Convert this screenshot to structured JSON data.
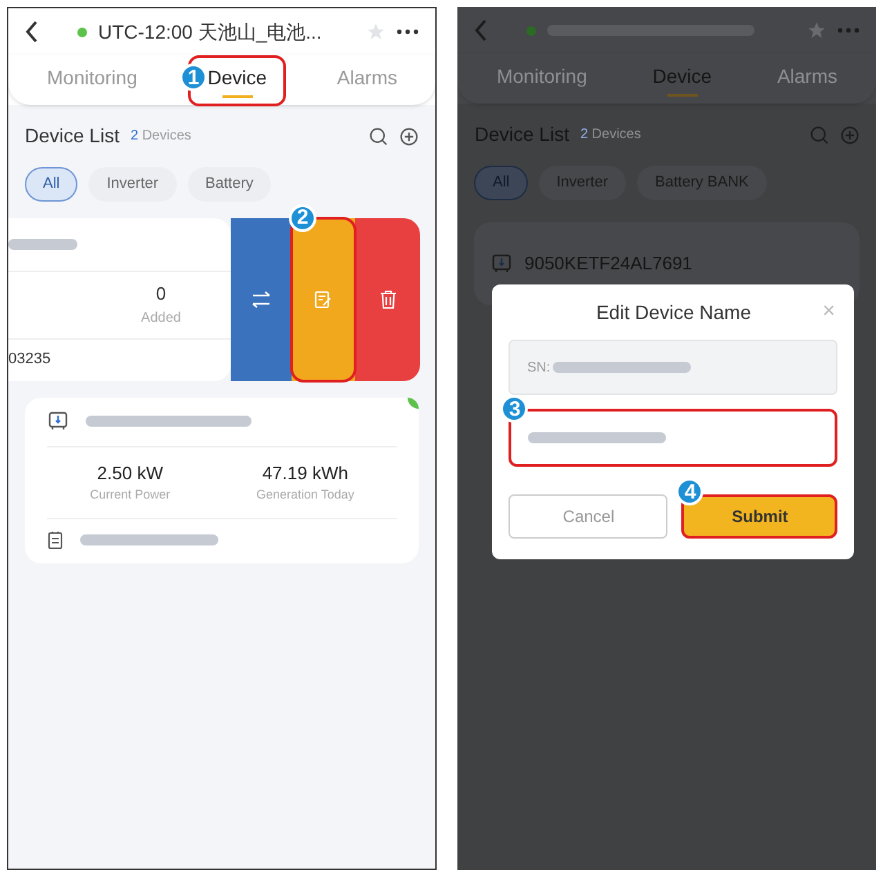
{
  "left": {
    "header": {
      "title": "UTC-12:00 天池山_电池..."
    },
    "tabs": [
      {
        "label": "Monitoring",
        "selected": false
      },
      {
        "label": "Device",
        "selected": true
      },
      {
        "label": "Alarms",
        "selected": false
      }
    ],
    "device_list": {
      "title": "Device List",
      "count": "2",
      "count_label": "Devices"
    },
    "filters": [
      {
        "label": "All",
        "selected": true
      },
      {
        "label": "Inverter",
        "selected": false
      },
      {
        "label": "Battery",
        "selected": false
      }
    ],
    "swiped_card": {
      "value": "0",
      "value_label": "Added",
      "serial_tail": "03235"
    },
    "card": {
      "stats": [
        {
          "value": "2.50",
          "unit": "kW",
          "label": "Current Power"
        },
        {
          "value": "47.19",
          "unit": "kWh",
          "label": "Generation Today"
        }
      ]
    },
    "steps": [
      "1",
      "2"
    ]
  },
  "right": {
    "tabs": [
      {
        "label": "Monitoring",
        "selected": false
      },
      {
        "label": "Device",
        "selected": true
      },
      {
        "label": "Alarms",
        "selected": false
      }
    ],
    "device_list": {
      "title": "Device List",
      "count": "2",
      "count_label": "Devices"
    },
    "filters": [
      {
        "label": "All",
        "selected": true
      },
      {
        "label": "Inverter",
        "selected": false
      },
      {
        "label": "Battery BANK",
        "selected": false
      }
    ],
    "card_name": "9050KETF24AL7691",
    "dialog": {
      "title": "Edit Device Name",
      "sn_label": "SN:",
      "close": "×",
      "cancel": "Cancel",
      "submit": "Submit"
    },
    "steps": [
      "3",
      "4"
    ]
  }
}
